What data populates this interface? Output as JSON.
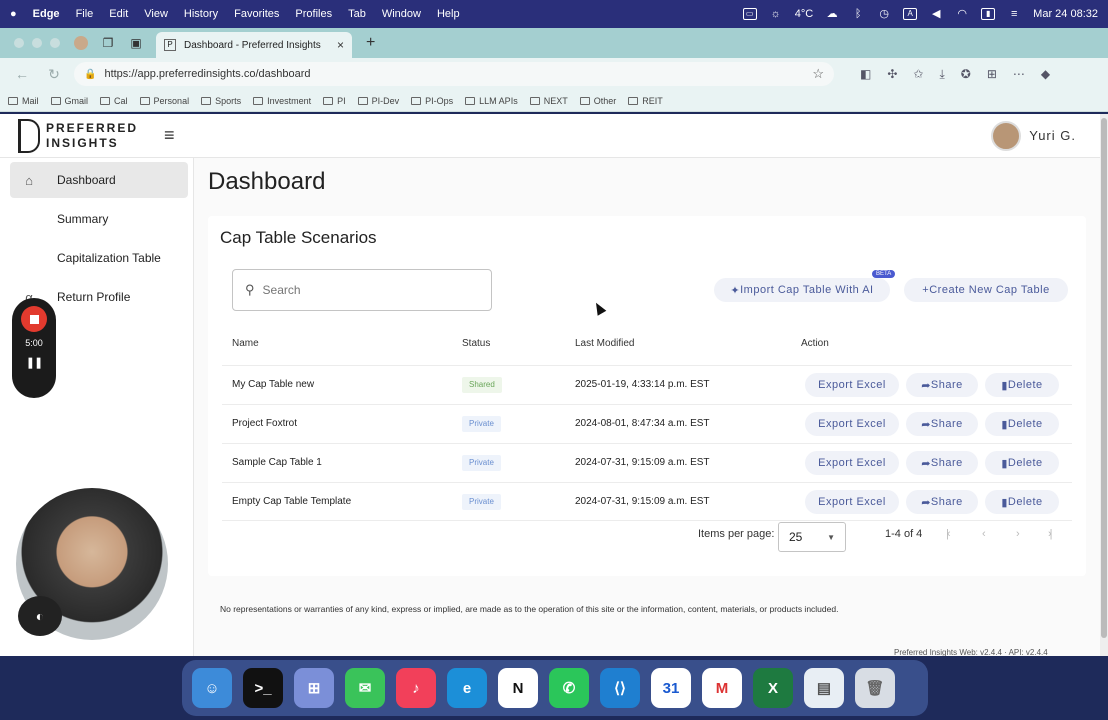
{
  "menubar": {
    "apple": "",
    "app_name": "Edge",
    "items": [
      "File",
      "Edit",
      "View",
      "History",
      "Favorites",
      "Profiles",
      "Tab",
      "Window",
      "Help"
    ],
    "weather": "4°C",
    "date_time": "Mar 24  08:32"
  },
  "browser": {
    "tab_title": "Dashboard - Preferred Insights",
    "url": "https://app.preferredinsights.co/dashboard",
    "bookmarks": [
      "Mail",
      "Gmail",
      "Cal",
      "Personal",
      "Sports",
      "Investment",
      "PI",
      "PI-Dev",
      "PI-Ops",
      "LLM APIs",
      "NEXT",
      "Other",
      "REIT"
    ]
  },
  "app": {
    "logo_line1": "PREFERRED",
    "logo_line2": "INSIGHTS",
    "user_name": "Yuri G.",
    "sidebar": [
      {
        "label": "Dashboard",
        "icon": "home-icon",
        "active": true
      },
      {
        "label": "Summary",
        "icon": "summary-icon",
        "active": false
      },
      {
        "label": "Capitalization Table",
        "icon": "table-icon",
        "active": false
      },
      {
        "label": "Return Profile",
        "icon": "alpha-icon",
        "glyph": "α",
        "active": false
      }
    ],
    "recorder": {
      "time": "5:00"
    },
    "page_title": "Dashboard",
    "card_title": "Cap Table Scenarios",
    "search_placeholder": "Search",
    "import_button": "Import Cap Table With AI",
    "beta_badge": "BETA",
    "create_button": "Create New Cap Table",
    "columns": [
      "Name",
      "Status",
      "Last Modified",
      "Action"
    ],
    "rows": [
      {
        "name": "My Cap Table new",
        "status": "Shared",
        "modified": "2025-01-19, 4:33:14 p.m. EST"
      },
      {
        "name": "Project Foxtrot",
        "status": "Private",
        "modified": "2024-08-01, 8:47:34 a.m. EST"
      },
      {
        "name": "Sample Cap Table 1",
        "status": "Private",
        "modified": "2024-07-31, 9:15:09 a.m. EST"
      },
      {
        "name": "Empty Cap Table Template",
        "status": "Private",
        "modified": "2024-07-31, 9:15:09 a.m. EST"
      }
    ],
    "actions": {
      "export": "Export Excel",
      "share": "Share",
      "delete": "Delete"
    },
    "pagination": {
      "items_label": "Items per page:",
      "per_page": "25",
      "range": "1-4 of 4"
    },
    "disclaimer": "No representations or warranties of any kind, express or implied, are made as to the operation of this site or the information, content, materials, or products included.",
    "version": "Preferred Insights Web: v2.4.4 · API: v2.4.4"
  },
  "colors": {
    "accent_text": "#4a5a9a",
    "button_bg": "#f0f2f8",
    "shared": "#6aa65a",
    "private": "#6a8fd0",
    "record": "#e23a2e"
  },
  "dock": [
    "Finder",
    "Terminal",
    "Launchpad",
    "Messages",
    "Music",
    "Edge",
    "Notion",
    "WhatsApp",
    "VS Code",
    "Calendar",
    "Gmail",
    "Excel",
    "Preview",
    "Trash"
  ]
}
